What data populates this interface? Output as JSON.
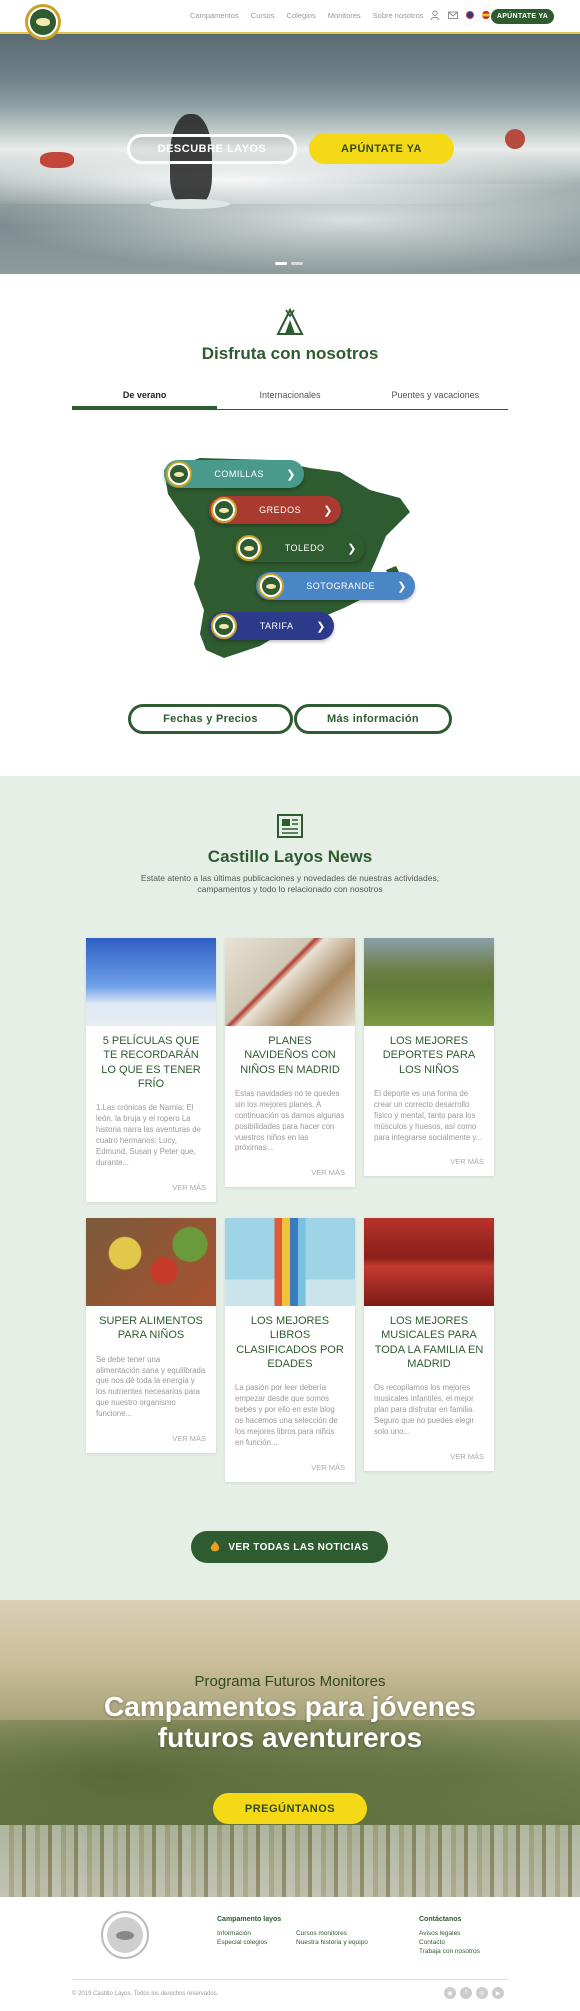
{
  "header": {
    "nav": [
      "Campamentos",
      "Cursos",
      "Colegios",
      "Monitores",
      "Sobre nosotros"
    ],
    "cta": "APÚNTATE YA"
  },
  "hero": {
    "btn_discover": "DESCUBRE LAYOS",
    "btn_signup": "APÚNTATE YA"
  },
  "enjoy": {
    "title": "Disfruta con nosotros",
    "tabs": [
      "De verano",
      "Internacionales",
      "Puentes y vacaciones"
    ],
    "camps": [
      {
        "label": "COMILLAS",
        "color": "#4a9a8c"
      },
      {
        "label": "GREDOS",
        "color": "#a83a2f"
      },
      {
        "label": "TOLEDO",
        "color": "#2e5b2f"
      },
      {
        "label": "SOTOGRANDE",
        "color": "#4a86c6"
      },
      {
        "label": "TARIFA",
        "color": "#2b3a8a"
      }
    ],
    "btn_dates": "Fechas y Precios",
    "btn_info": "Más información"
  },
  "news": {
    "title": "Castillo Layos News",
    "subtitle": "Estate atento a las últimas publicaciones y novedades de nuestras actividades, campamentos y todo lo relacionado con nosotros",
    "read_more": "VER MÁS",
    "cards": [
      {
        "title": "5 PELÍCULAS QUE TE RECORDARÁN LO QUE ES TENER FRÍO",
        "text": "1.Las crónicas de Narnia: El león, la bruja y el ropero La historia narra las aventuras de cuatro hermanos: Lucy, Edmund, Susan y Peter que, durante..."
      },
      {
        "title": "PLANES NAVIDEÑOS CON NIÑOS EN MADRID",
        "text": "Estas navidades no te quedes sin los mejores planes. A continuación os damos algunas posibilidades para hacer con vuestros niños en las próximas..."
      },
      {
        "title": "LOS MEJORES DEPORTES PARA LOS NIÑOS",
        "text": "El deporte es una forma de crear un correcto desarrollo físico y mental, tanto para los músculos y huesos, así como para integrarse socialmente y..."
      },
      {
        "title": "SUPER ALIMENTOS PARA NIÑOS",
        "text": "Se debe tener una alimentación sana y equilibrada que nos dé toda la energía y los nutrientes necesarios para que nuestro organismo funcione..."
      },
      {
        "title": "LOS MEJORES LIBROS CLASIFICADOS POR EDADES",
        "text": "La pasión por leer debería empezar desde que somos bebés y por ello en este blog os hacemos una selección de los mejores libros para niños en función..."
      },
      {
        "title": "LOS MEJORES MUSICALES PARA TODA LA FAMILIA EN MADRID",
        "text": "Os recopilamos los mejores musicales infantiles, el mejor plan para disfrutar en familia. Seguro que no puedes elegir solo uno..."
      }
    ],
    "btn_all": "VER TODAS LAS NOTICIAS"
  },
  "futuros": {
    "subtitle": "Programa Futuros Monitores",
    "title_line1": "Campamentos para jóvenes",
    "title_line2": "futuros aventureros",
    "btn": "PREGÚNTANOS"
  },
  "footer": {
    "col1_head": "Campamento layos",
    "col1_links": [
      "Información",
      "Especial colegios"
    ],
    "col2_links": [
      "Cursos monitores",
      "Nuestra historia y equipo"
    ],
    "col3_head": "Contáctanos",
    "col3_links": [
      "Avisos legales",
      "Contacto",
      "Trabaja con nosotros"
    ],
    "copyright": "© 2019 Castillo Layos. Todos los derechos reservados."
  }
}
